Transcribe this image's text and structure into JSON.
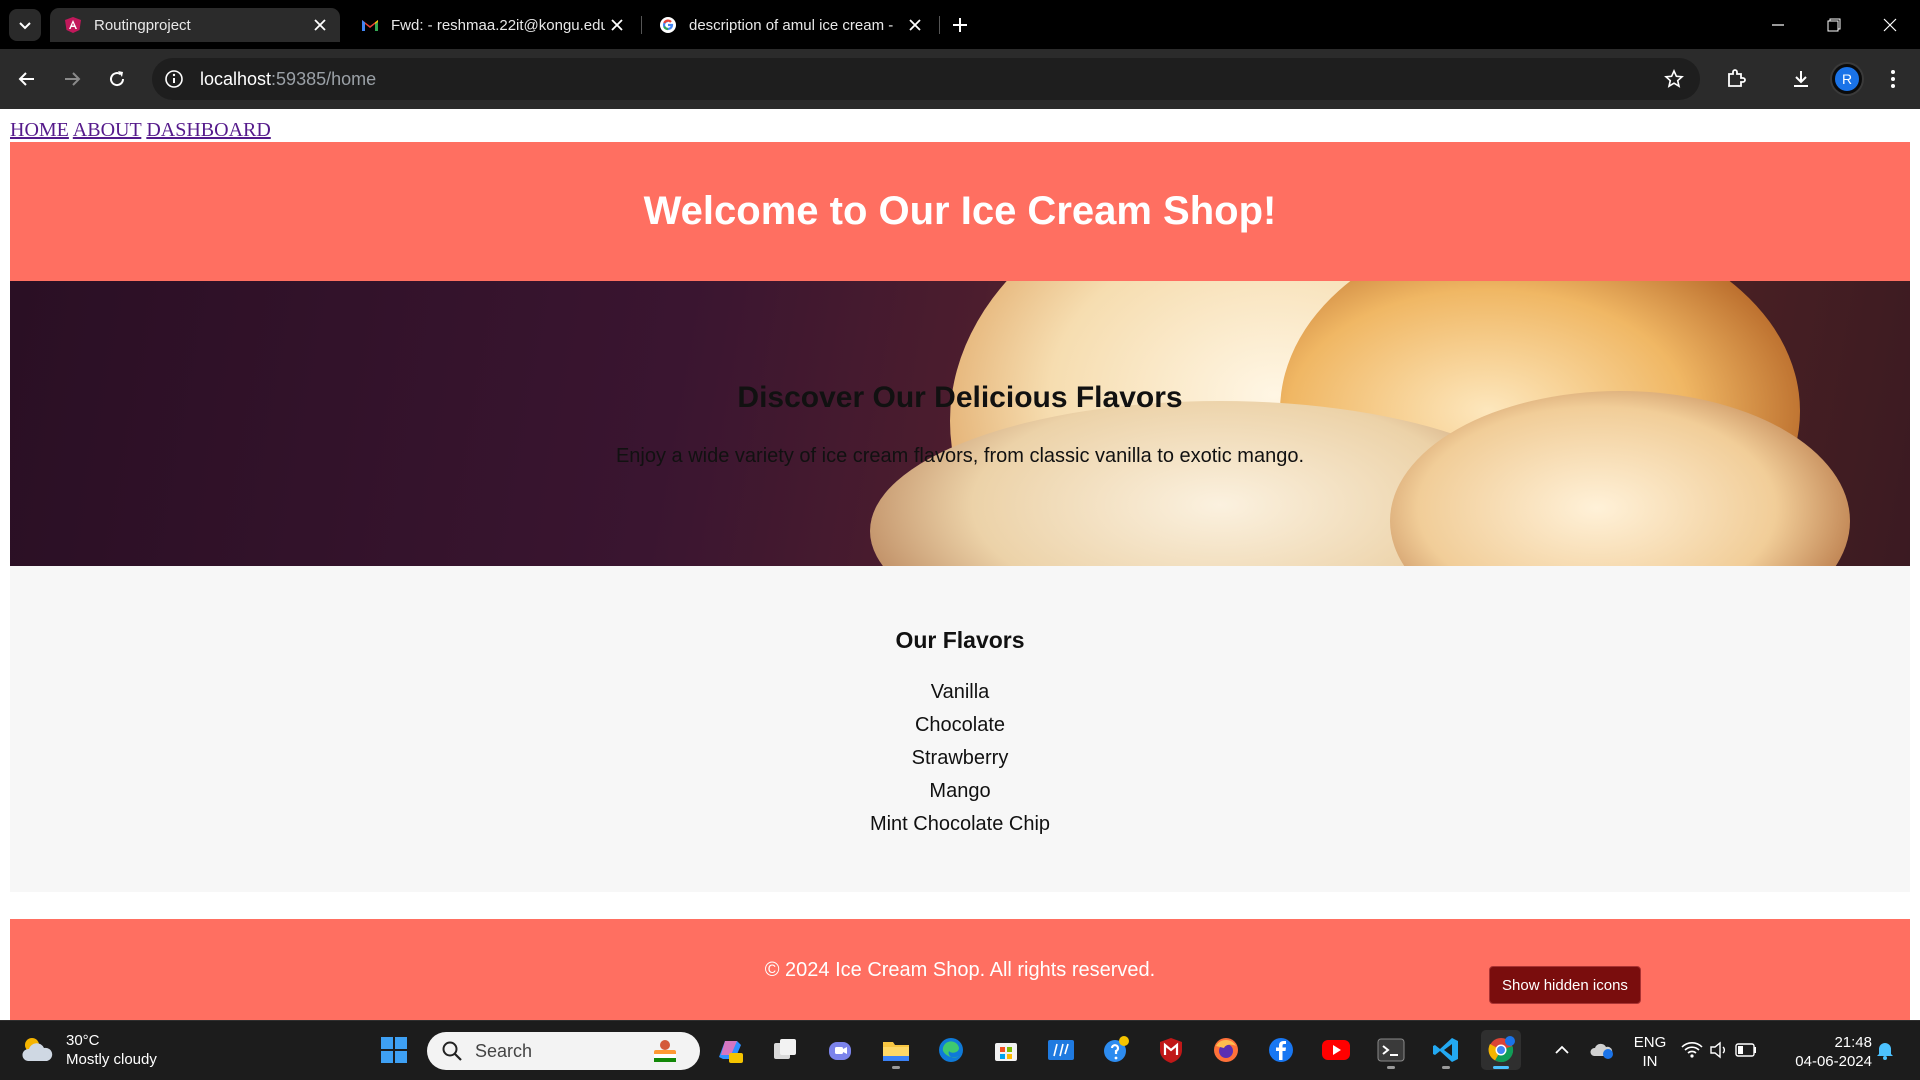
{
  "browser": {
    "tabs": [
      {
        "title": "Routingproject",
        "active": true,
        "favicon": "angular-icon"
      },
      {
        "title": "Fwd: - reshmaa.22it@kongu.edu",
        "active": false,
        "favicon": "gmail-icon"
      },
      {
        "title": "description of amul ice cream -",
        "active": false,
        "favicon": "google-icon"
      }
    ],
    "url_host": "localhost",
    "url_path": ":59385/home",
    "profile_initial": "R"
  },
  "page": {
    "nav": [
      "HOME",
      "ABOUT",
      "DASHBOARD"
    ],
    "header_title": "Welcome to Our Ice Cream Shop!",
    "hero_title": "Discover Our Delicious Flavors",
    "hero_text": "Enjoy a wide variety of ice cream flavors, from classic vanilla to exotic mango.",
    "flavors_title": "Our Flavors",
    "flavors": [
      "Vanilla",
      "Chocolate",
      "Strawberry",
      "Mango",
      "Mint Chocolate Chip"
    ],
    "footer_text": "© 2024 Ice Cream Shop. All rights reserved."
  },
  "tooltip": "Show hidden icons",
  "taskbar": {
    "weather_temp": "30°C",
    "weather_desc": "Mostly cloudy",
    "search_label": "Search",
    "lang_top": "ENG",
    "lang_bottom": "IN",
    "time": "21:48",
    "date": "04-06-2024"
  },
  "colors": {
    "accent": "#ff6f61",
    "flavors_bg": "#f7f7f7",
    "link": "#551a8b"
  }
}
